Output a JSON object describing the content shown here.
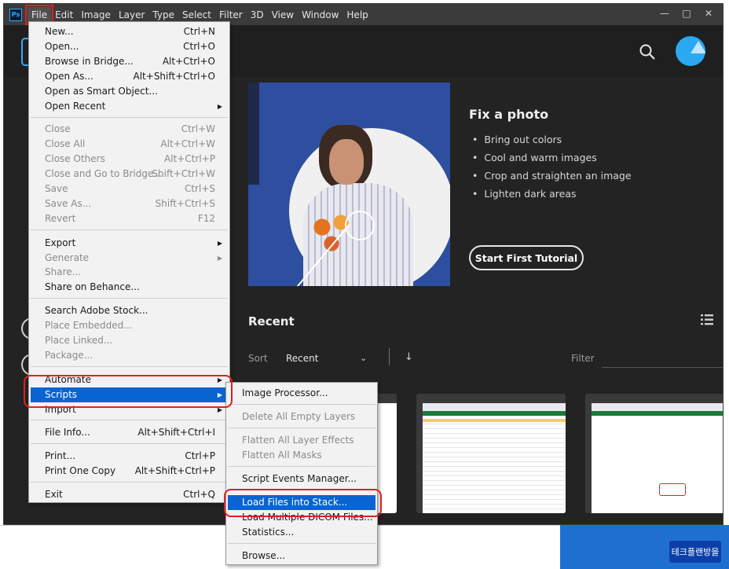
{
  "app": {
    "logo": "Ps"
  },
  "menubar": [
    "File",
    "Edit",
    "Image",
    "Layer",
    "Type",
    "Select",
    "Filter",
    "3D",
    "View",
    "Window",
    "Help"
  ],
  "window_controls": {
    "minimize": "—",
    "maximize": "□",
    "close": "✕"
  },
  "header": {
    "search_icon": "search-icon",
    "avatar_icon": "avatar"
  },
  "hero": {
    "title": "Fix a photo",
    "bullets": [
      "Bring out colors",
      "Cool and warm images",
      "Crop and straighten an image",
      "Lighten dark areas"
    ],
    "button": "Start First Tutorial"
  },
  "recent": {
    "title": "Recent",
    "sort_label": "Sort",
    "sort_value": "Recent",
    "sort_chevron": "⌄",
    "sort_direction": "↓",
    "filter_label": "Filter"
  },
  "file_menu": {
    "items": [
      {
        "label": "New...",
        "shortcut": "Ctrl+N"
      },
      {
        "label": "Open...",
        "shortcut": "Ctrl+O"
      },
      {
        "label": "Browse in Bridge...",
        "shortcut": "Alt+Ctrl+O"
      },
      {
        "label": "Open As...",
        "shortcut": "Alt+Shift+Ctrl+O"
      },
      {
        "label": "Open as Smart Object...",
        "shortcut": ""
      },
      {
        "label": "Open Recent",
        "shortcut": "",
        "submenu": "▶"
      },
      {
        "label": "Close",
        "shortcut": "Ctrl+W"
      },
      {
        "label": "Close All",
        "shortcut": "Alt+Ctrl+W"
      },
      {
        "label": "Close Others",
        "shortcut": "Alt+Ctrl+P"
      },
      {
        "label": "Close and Go to Bridge...",
        "shortcut": "Shift+Ctrl+W"
      },
      {
        "label": "Save",
        "shortcut": "Ctrl+S"
      },
      {
        "label": "Save As...",
        "shortcut": "Shift+Ctrl+S"
      },
      {
        "label": "Revert",
        "shortcut": "F12"
      },
      {
        "label": "Export",
        "shortcut": "",
        "submenu": "▶"
      },
      {
        "label": "Generate",
        "shortcut": "",
        "submenu": "▶"
      },
      {
        "label": "Share...",
        "shortcut": ""
      },
      {
        "label": "Share on Behance...",
        "shortcut": ""
      },
      {
        "label": "Search Adobe Stock...",
        "shortcut": ""
      },
      {
        "label": "Place Embedded...",
        "shortcut": ""
      },
      {
        "label": "Place Linked...",
        "shortcut": ""
      },
      {
        "label": "Package...",
        "shortcut": ""
      },
      {
        "label": "Automate",
        "shortcut": "",
        "submenu": "▶"
      },
      {
        "label": "Scripts",
        "shortcut": "",
        "submenu": "▶"
      },
      {
        "label": "Import",
        "shortcut": "",
        "submenu": "▶"
      },
      {
        "label": "File Info...",
        "shortcut": "Alt+Shift+Ctrl+I"
      },
      {
        "label": "Print...",
        "shortcut": "Ctrl+P"
      },
      {
        "label": "Print One Copy",
        "shortcut": "Alt+Shift+Ctrl+P"
      },
      {
        "label": "Exit",
        "shortcut": "Ctrl+Q"
      }
    ]
  },
  "scripts_menu": {
    "items": [
      "Image Processor...",
      "Delete All Empty Layers",
      "Flatten All Layer Effects",
      "Flatten All Masks",
      "Script Events Manager...",
      "Load Files into Stack...",
      "Load Multiple DICOM Files...",
      "Statistics...",
      "Browse..."
    ]
  },
  "watermark": "테크플랜방을",
  "colors": {
    "accent": "#31a8ff",
    "highlight": "#0a64d2",
    "annotation": "#e02020"
  }
}
